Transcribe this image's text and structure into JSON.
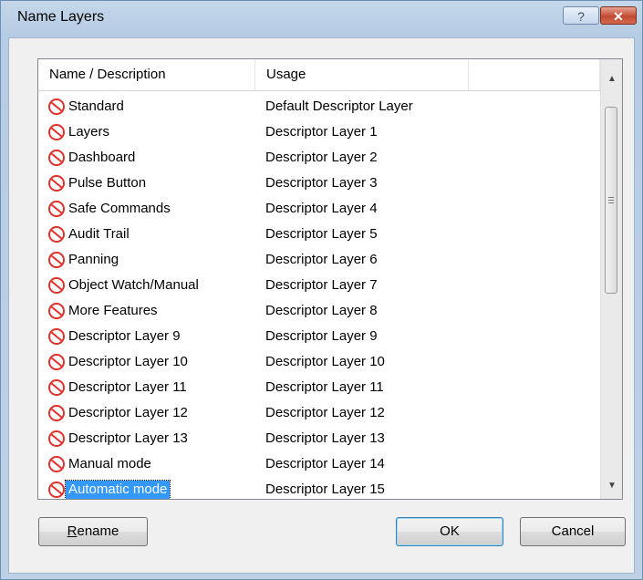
{
  "window": {
    "title": "Name Layers",
    "help_label": "?",
    "close_label": "✕"
  },
  "list": {
    "columns": [
      "Name / Description",
      "Usage",
      ""
    ],
    "rows": [
      {
        "name": "Standard",
        "usage": "Default Descriptor Layer"
      },
      {
        "name": "Layers",
        "usage": "Descriptor Layer 1"
      },
      {
        "name": "Dashboard",
        "usage": "Descriptor Layer 2"
      },
      {
        "name": "Pulse Button",
        "usage": "Descriptor Layer 3"
      },
      {
        "name": "Safe Commands",
        "usage": "Descriptor Layer 4"
      },
      {
        "name": "Audit Trail",
        "usage": "Descriptor Layer 5"
      },
      {
        "name": "Panning",
        "usage": "Descriptor Layer 6"
      },
      {
        "name": "Object Watch/Manual",
        "usage": "Descriptor Layer 7"
      },
      {
        "name": "More Features",
        "usage": "Descriptor Layer 8"
      },
      {
        "name": "Descriptor Layer 9",
        "usage": "Descriptor Layer 9"
      },
      {
        "name": "Descriptor Layer 10",
        "usage": "Descriptor Layer 10"
      },
      {
        "name": "Descriptor Layer 11",
        "usage": "Descriptor Layer 11"
      },
      {
        "name": "Descriptor Layer 12",
        "usage": "Descriptor Layer 12"
      },
      {
        "name": "Descriptor Layer 13",
        "usage": "Descriptor Layer 13"
      },
      {
        "name": "Manual mode",
        "usage": "Descriptor Layer 14"
      },
      {
        "name": "Automatic mode",
        "usage": "Descriptor Layer 15",
        "selected": true
      }
    ],
    "row_icon": "layer-hidden-icon",
    "selection_color": "#3399ff"
  },
  "buttons": {
    "rename_first": "R",
    "rename_rest": "ename",
    "ok": "OK",
    "cancel": "Cancel"
  },
  "colors": {
    "icon_red": "#e0312b",
    "titlebar": "#b9cfe6",
    "close_button": "#c44a32"
  }
}
